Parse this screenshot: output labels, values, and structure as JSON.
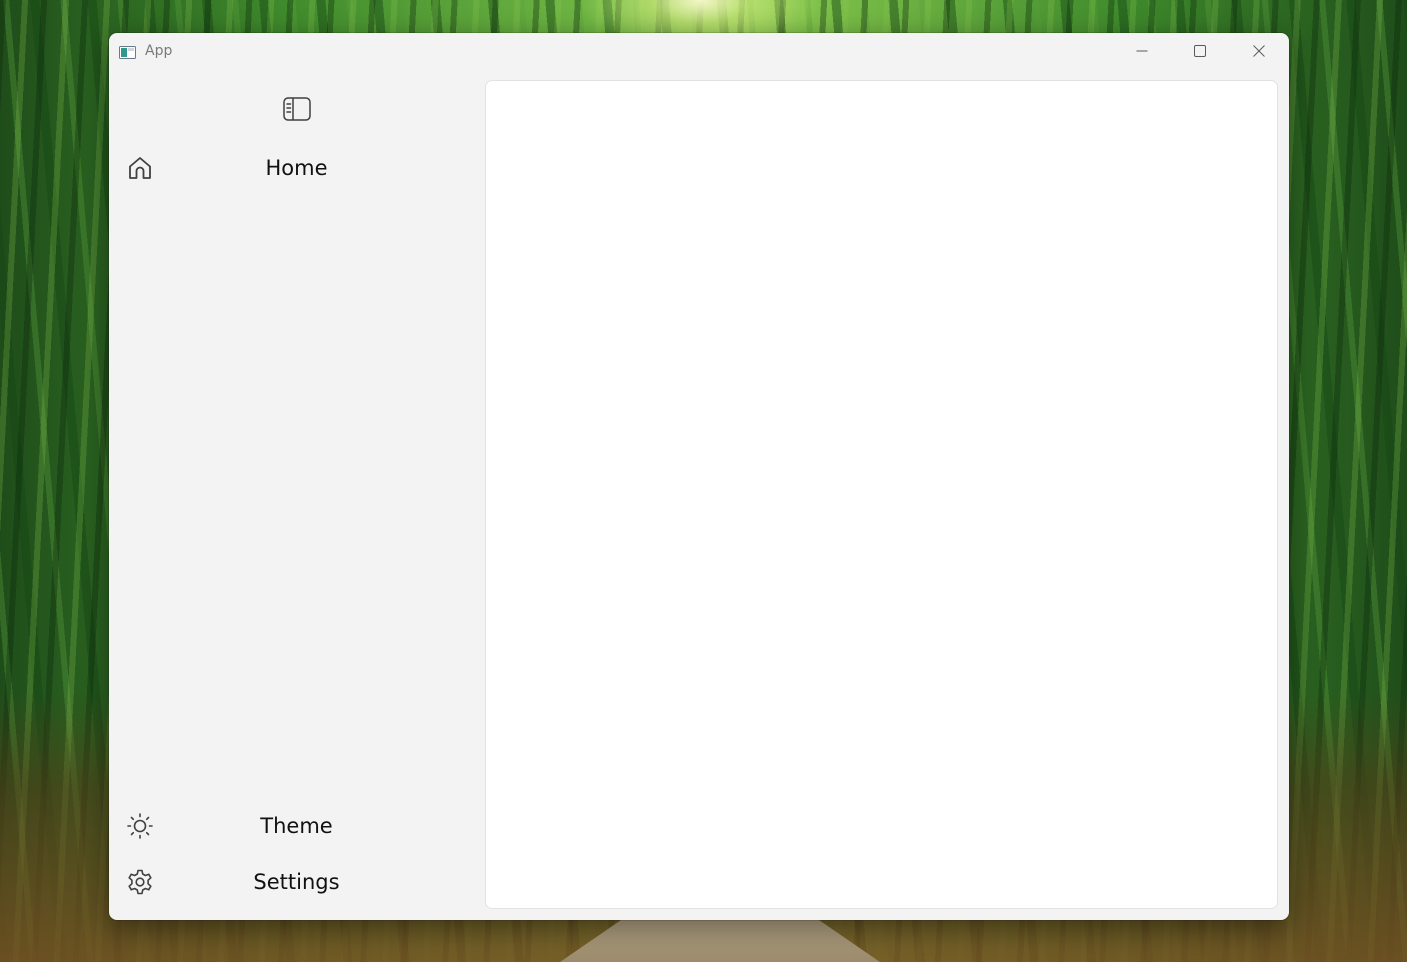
{
  "window": {
    "title": "App"
  },
  "titlebar": {
    "icons": {
      "app": "app-window-icon",
      "minimize": "minimize-icon",
      "maximize": "maximize-icon",
      "close": "close-icon"
    }
  },
  "sidebar": {
    "toggle_icon": "sidebar-toggle-icon",
    "items": [
      {
        "label": "Home",
        "icon": "home-icon"
      }
    ],
    "footer_items": [
      {
        "label": "Theme",
        "icon": "sun-icon"
      },
      {
        "label": "Settings",
        "icon": "gear-icon"
      }
    ]
  },
  "colors": {
    "window_background": "#f3f3f3",
    "content_background": "#ffffff",
    "text": "#111111",
    "title_text": "#7a7a7a"
  }
}
